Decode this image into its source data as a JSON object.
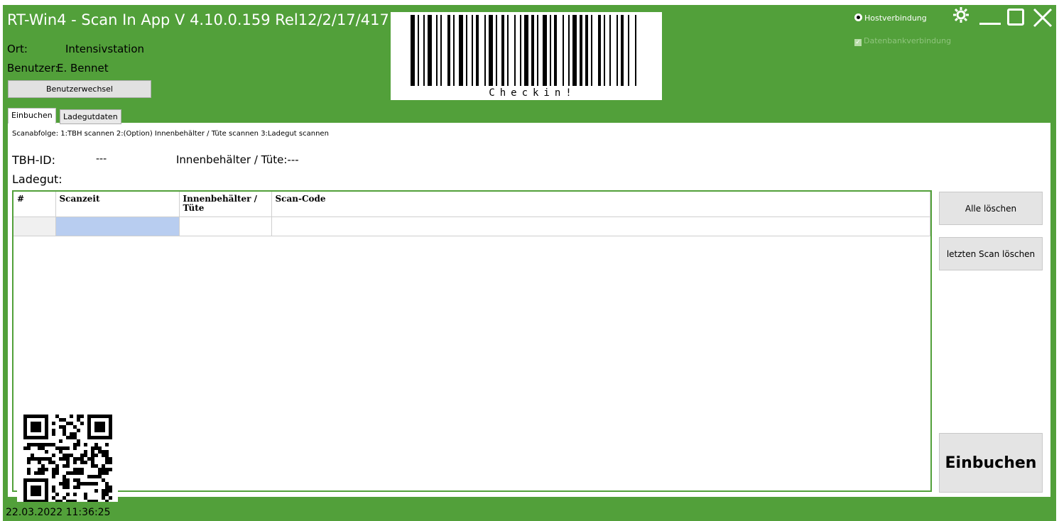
{
  "header": {
    "app_title": "RT-Win4  -  Scan In App   V 4.10.0.159 Rel12/2/17/417",
    "location_label": "Ort:",
    "location_value": "Intensivstation",
    "user_label": "Benutzer:",
    "user_value": "E. Bennet",
    "switch_user_button": "Benutzerwechsel"
  },
  "barcode": {
    "text": "Checkin!"
  },
  "connections": {
    "host_label": "Hostverbindung",
    "host_selected": true,
    "db_label": "Datenbankverbindung",
    "db_checked": true
  },
  "window_controls": {
    "settings_icon": "gear-icon",
    "minimize_icon": "minimize-icon",
    "maximize_icon": "maximize-icon",
    "close_icon": "close-icon"
  },
  "tabs": [
    {
      "label": "Einbuchen",
      "active": true
    },
    {
      "label": "Ladegutdaten",
      "active": false
    }
  ],
  "main": {
    "scan_sequence": "Scanabfolge: 1:TBH scannen 2:(Option) Innenbehälter / Tüte scannen 3:Ladegut scannen",
    "tbh_label": "TBH-ID:",
    "tbh_value": "---",
    "inner_label": "Innenbehälter / Tüte:---",
    "ladegut_label": "Ladegut:"
  },
  "table": {
    "columns": [
      "#",
      "Scanzeit",
      "Innenbehälter / Tüte",
      "Scan-Code"
    ],
    "rows": [
      [
        "",
        "",
        "",
        ""
      ]
    ]
  },
  "side_buttons": {
    "delete_all": "Alle löschen",
    "delete_last": "letzten Scan löschen",
    "book_in": "Einbuchen"
  },
  "status": {
    "timestamp": "22.03.2022 11:36:25"
  },
  "colors": {
    "accent": "#52a03a",
    "selected_cell": "#b8cdf0"
  }
}
